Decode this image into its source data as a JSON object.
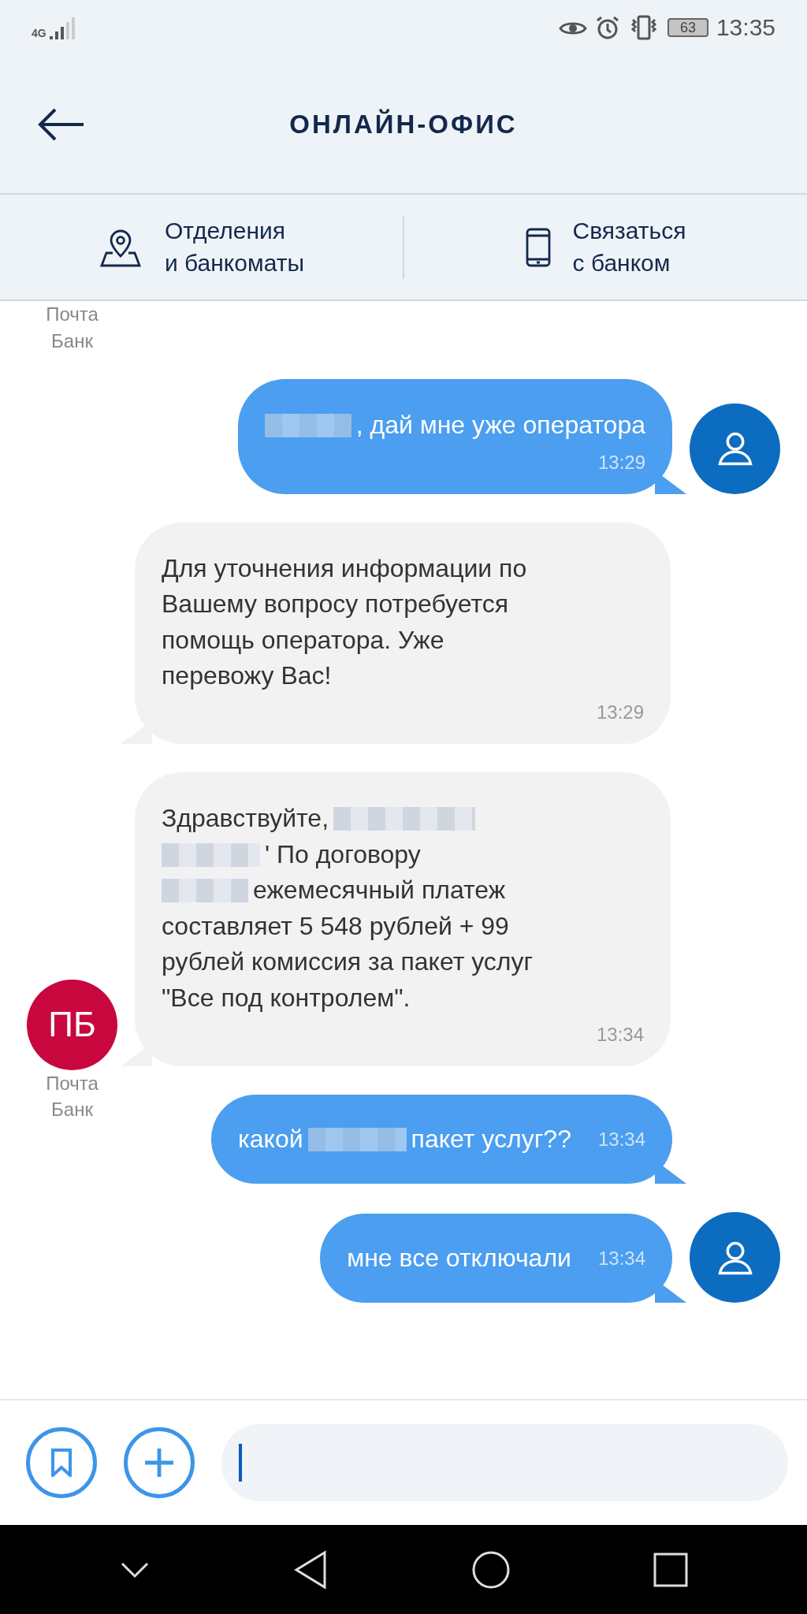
{
  "status_bar": {
    "network": "4G",
    "battery": "63",
    "time": "13:35"
  },
  "header": {
    "title": "ОНЛАЙН-ОФИС"
  },
  "actions": [
    {
      "kind": "branches",
      "lines": [
        "Отделения",
        "и банкоматы"
      ]
    },
    {
      "kind": "contact",
      "lines": [
        "Связаться",
        "с банком"
      ]
    }
  ],
  "top_caption": [
    "Почта",
    "Банк"
  ],
  "messages": [
    {
      "kind": "sent",
      "time_inline": false,
      "avatar": true,
      "time": "13:29",
      "lines": [
        [
          {
            "kind": "redacted"
          },
          {
            "kind": "text",
            "text": ", дай мне уже оператора"
          }
        ]
      ]
    },
    {
      "kind": "received",
      "time_inline": false,
      "avatar": false,
      "time": "13:29",
      "lines": [
        [
          {
            "kind": "text",
            "text": "Для уточнения информации по"
          }
        ],
        [
          {
            "kind": "text",
            "text": "Вашему вопросу потребуется"
          }
        ],
        [
          {
            "kind": "text",
            "text": "помощь оператора. Уже"
          }
        ],
        [
          {
            "kind": "text",
            "text": "перевожу Вас!"
          }
        ]
      ]
    },
    {
      "kind": "received",
      "time_inline": false,
      "avatar": true,
      "avatar_text": "ПБ",
      "caption": [
        "Почта",
        "Банк"
      ],
      "time": "13:34",
      "lines": [
        [
          {
            "kind": "text",
            "text": "Здравствуйте,"
          },
          {
            "kind": "redacted"
          }
        ],
        [
          {
            "kind": "redacted"
          },
          {
            "kind": "text",
            "text": "' По договору"
          }
        ],
        [
          {
            "kind": "redacted"
          },
          {
            "kind": "text",
            "text": "ежемесячный платеж"
          }
        ],
        [
          {
            "kind": "text",
            "text": "составляет 5 548 рублей + 99"
          }
        ],
        [
          {
            "kind": "text",
            "text": "рублей комиссия за пакет услуг"
          }
        ],
        [
          {
            "kind": "text",
            "text": "\"Все под контролем\"."
          }
        ]
      ]
    },
    {
      "kind": "sent",
      "time_inline": true,
      "avatar": false,
      "time": "13:34",
      "lines": [
        [
          {
            "kind": "text",
            "text": "какой"
          },
          {
            "kind": "redacted"
          },
          {
            "kind": "text",
            "text": "пакет услуг??"
          }
        ]
      ]
    },
    {
      "kind": "sent",
      "time_inline": true,
      "avatar": true,
      "time": "13:34",
      "lines": [
        [
          {
            "kind": "text",
            "text": "мне все отключали"
          }
        ]
      ]
    }
  ],
  "composer": {
    "buttons": [
      {
        "kind": "bookmark"
      },
      {
        "kind": "add"
      }
    ],
    "focused": true
  }
}
